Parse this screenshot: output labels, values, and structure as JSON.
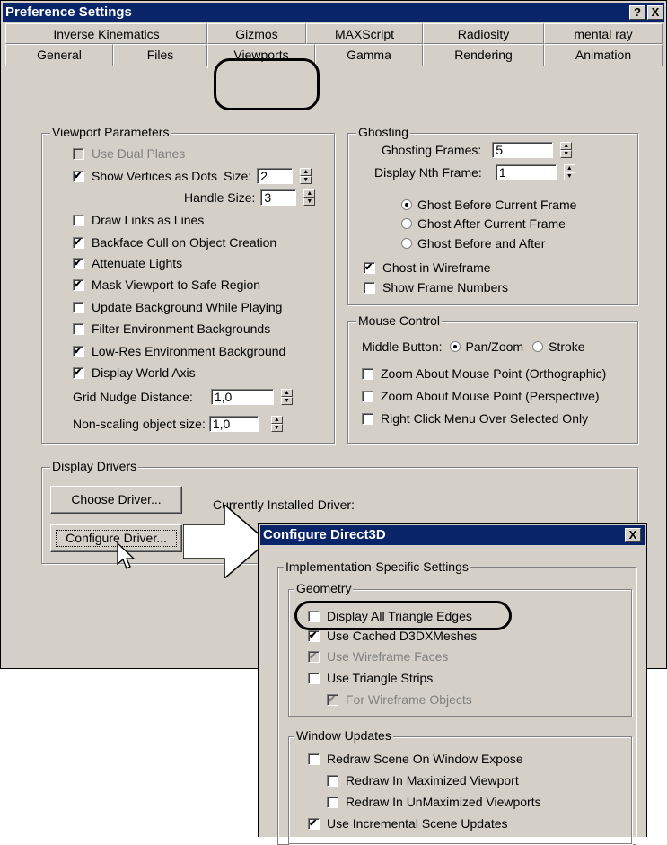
{
  "main_window": {
    "title": "Preference Settings",
    "help_btn": "?",
    "close_btn": "X",
    "tabs_row1": [
      "Inverse Kinematics",
      "Gizmos",
      "MAXScript",
      "Radiosity",
      "mental ray"
    ],
    "tabs_row2": [
      "General",
      "Files",
      "Viewports",
      "Gamma",
      "Rendering",
      "Animation"
    ],
    "viewport_params": {
      "label": "Viewport Parameters",
      "use_dual_planes": "Use Dual Planes",
      "show_vertices": "Show Vertices as Dots",
      "size_label": "Size:",
      "size_value": "2",
      "handle_size_label": "Handle Size:",
      "handle_size_value": "3",
      "draw_links": "Draw Links as Lines",
      "backface_cull": "Backface Cull on Object Creation",
      "attenuate": "Attenuate Lights",
      "mask_viewport": "Mask Viewport to Safe Region",
      "update_bg": "Update Background While Playing",
      "filter_env": "Filter Environment Backgrounds",
      "lowres_env": "Low-Res Environment Background",
      "display_axis": "Display World Axis",
      "grid_nudge_label": "Grid Nudge Distance:",
      "grid_nudge_value": "1,0",
      "nonscaling_label": "Non-scaling object size:",
      "nonscaling_value": "1,0"
    },
    "ghosting": {
      "label": "Ghosting",
      "frames_label": "Ghosting Frames:",
      "frames_value": "5",
      "nth_label": "Display Nth Frame:",
      "nth_value": "1",
      "before": "Ghost Before Current Frame",
      "after": "Ghost After Current Frame",
      "before_after": "Ghost Before and After",
      "wireframe": "Ghost in Wireframe",
      "frame_numbers": "Show Frame Numbers"
    },
    "mouse_control": {
      "label": "Mouse Control",
      "middle_label": "Middle Button:",
      "pan_zoom": "Pan/Zoom",
      "stroke": "Stroke",
      "zoom_ortho": "Zoom About Mouse Point (Orthographic)",
      "zoom_persp": "Zoom About Mouse Point (Perspective)",
      "right_click": "Right Click Menu Over Selected Only"
    },
    "display_drivers": {
      "label": "Display Drivers",
      "choose_btn": "Choose Driver...",
      "installed_label": "Currently Installed Driver:",
      "configure_btn": "Configure Driver..."
    }
  },
  "dialog": {
    "title": "Configure Direct3D",
    "close_btn": "X",
    "impl_label": "Implementation-Specific Settings",
    "geometry": {
      "label": "Geometry",
      "display_all_edges": "Display All Triangle Edges",
      "cached_meshes": "Use Cached D3DXMeshes",
      "wire_faces": "Use Wireframe Faces",
      "tri_strips": "Use Triangle Strips",
      "for_wire": "For Wireframe Objects"
    },
    "window_updates": {
      "label": "Window Updates",
      "redraw_expose": "Redraw Scene On Window Expose",
      "redraw_max": "Redraw In Maximized Viewport",
      "redraw_unmax": "Redraw In UnMaximized Viewports",
      "incremental": "Use Incremental Scene Updates"
    }
  },
  "colors": {
    "titlebar": "#0a246a",
    "face": "#d4d0c8",
    "shadow": "#808080",
    "highlight": "#ffffff"
  }
}
